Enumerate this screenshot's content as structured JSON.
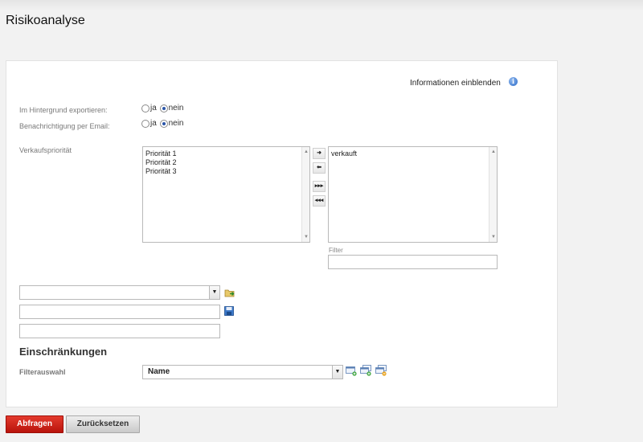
{
  "page": {
    "title": "Risikoanalyse"
  },
  "info": {
    "label": "Informationen einblenden",
    "icon": "info-icon"
  },
  "options": {
    "background_export": {
      "label": "Im Hintergrund exportieren:",
      "yes": "ja",
      "no": "nein",
      "selected": "nein"
    },
    "email_notification": {
      "label": "Benachrichtigung per Email:",
      "yes": "ja",
      "no": "nein",
      "selected": "nein"
    }
  },
  "sales_priority": {
    "label": "Verkaufspriorität",
    "available": [
      "Priorität 1",
      "Priorität 2",
      "Priorität 3"
    ],
    "selected": [
      "verkauft"
    ],
    "buttons": {
      "add": "➜",
      "remove": "⬅",
      "add_all": "▸▸▸",
      "remove_all": "◂◂◂"
    },
    "filter_label": "Filter",
    "filter_value": ""
  },
  "query_tools": {
    "saved_query_value": "",
    "query_name_value": "",
    "description_value": "",
    "load_icon": "folder-load-icon",
    "save_icon": "floppy-disk-icon"
  },
  "restrictions": {
    "title": "Einschränkungen",
    "filter_label": "Filterauswahl",
    "filter_value": "Name",
    "icons": [
      "add-filter-icon",
      "add-filter-group-icon",
      "remove-filter-icon"
    ]
  },
  "actions": {
    "submit": "Abfragen",
    "reset": "Zurücksetzen"
  },
  "colors": {
    "primary": "#cc2418",
    "panel_bg": "#ffffff",
    "page_bg": "#f2f2f2"
  }
}
